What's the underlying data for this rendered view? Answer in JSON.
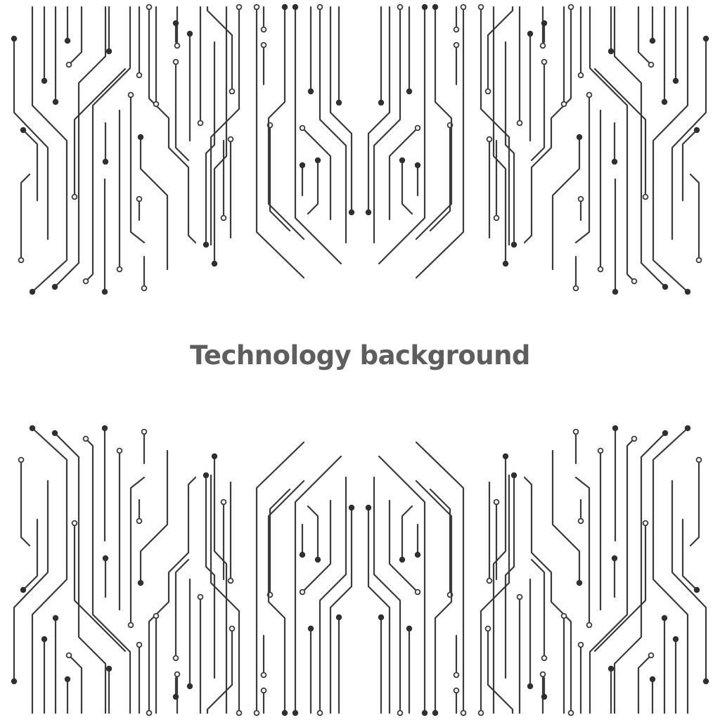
{
  "headline": "Technology background",
  "colors": {
    "background": "#ffffff",
    "trace": "#3a3a3a",
    "node": "#2f2f2f",
    "headline": "#5e5e5e"
  },
  "pattern": {
    "motif": "circuit-board traces",
    "arrangement": "top band mirrored vertically as bottom band, each band mirrored left-right",
    "terminals": [
      "filled-dot",
      "hollow-ring"
    ]
  }
}
